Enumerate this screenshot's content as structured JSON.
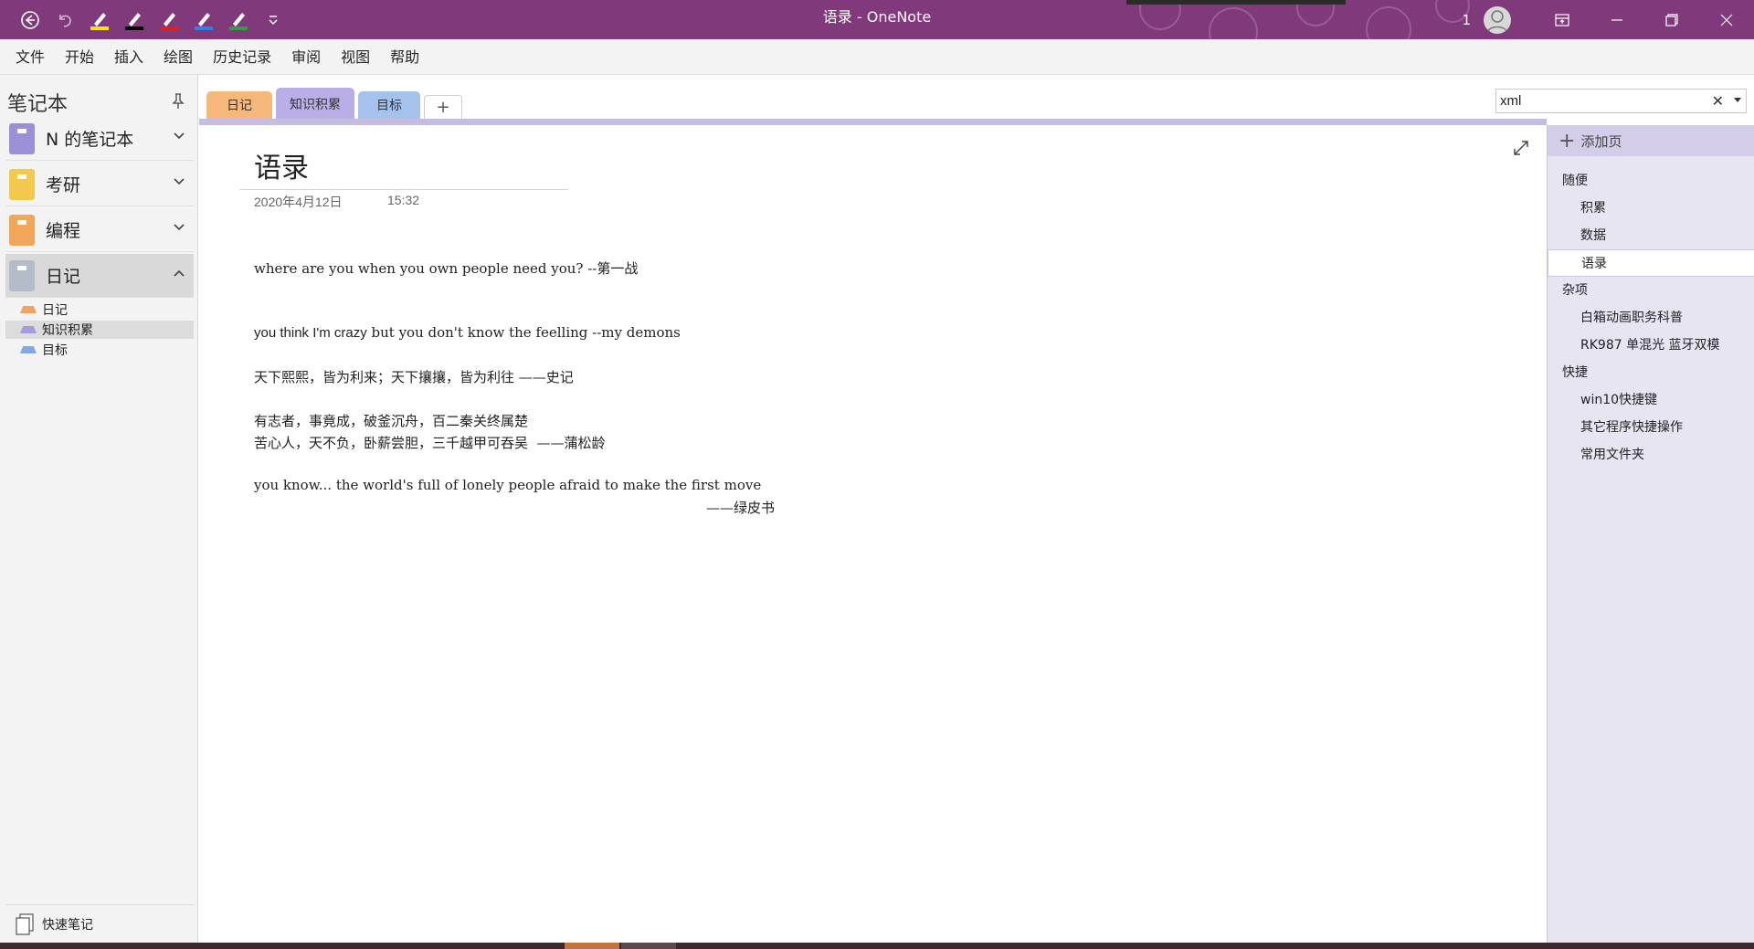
{
  "window": {
    "title": "语录 - OneNote",
    "user_count": "1"
  },
  "quick_access": [
    {
      "icon": "back-icon"
    },
    {
      "icon": "undo-icon"
    },
    {
      "icon": "highlighter-yellow-icon",
      "color": "#f5e500"
    },
    {
      "icon": "pen-black-icon",
      "color": "#000000"
    },
    {
      "icon": "pen-red-icon",
      "color": "#e0201c"
    },
    {
      "icon": "pen-blue-icon",
      "color": "#2f7fe8"
    },
    {
      "icon": "pen-green-icon",
      "color": "#2ea043"
    },
    {
      "icon": "customize-dropdown-icon"
    }
  ],
  "menu": [
    "文件",
    "开始",
    "插入",
    "绘图",
    "历史记录",
    "审阅",
    "视图",
    "帮助"
  ],
  "left_pane": {
    "header": "笔记本",
    "notebooks": [
      {
        "label": "N 的笔记本",
        "color": "#9b8fd6",
        "expanded": false
      },
      {
        "label": "考研",
        "color": "#f2c94c",
        "expanded": false
      },
      {
        "label": "编程",
        "color": "#f2a65a",
        "expanded": false
      },
      {
        "label": "日记",
        "color": "#b5bcc9",
        "expanded": true
      }
    ],
    "sections": [
      {
        "label": "日记",
        "color": "#f0a461"
      },
      {
        "label": "知识积累",
        "color": "#a89bdc"
      },
      {
        "label": "目标",
        "color": "#7fa9e0"
      }
    ],
    "quick_notes": "快速笔记"
  },
  "tabs": [
    {
      "label": "日记",
      "color": "#f6b77a"
    },
    {
      "label": "知识积累",
      "color": "#b9aee6"
    },
    {
      "label": "目标",
      "color": "#a5c2ec"
    }
  ],
  "tab_add": "+",
  "search": {
    "value": "xml"
  },
  "page": {
    "title": "语录",
    "date": "2020年4月12日",
    "time": "15:32",
    "lines": {
      "l1": "where are you when you own people need you? --第一战",
      "l2_sans": "you think I'm crazy",
      "l2_rest": " but you don't know the feelling --my demons",
      "l3": "天下熙熙，皆为利来；天下攘攘，皆为利往 ——史记",
      "l4": "有志者，事竟成，破釜沉舟，百二秦关终属楚",
      "l5": "苦心人，天不负，卧薪尝胆，三千越甲可吞吴  ——蒲松龄",
      "l6": "you know... the world's full of lonely people afraid to make the first move",
      "l7": "——绿皮书"
    }
  },
  "right_pane": {
    "add_page": "添加页",
    "pages": [
      {
        "label": "随便",
        "level": "top"
      },
      {
        "label": "积累",
        "level": "sub"
      },
      {
        "label": "数据",
        "level": "sub"
      },
      {
        "label": "语录",
        "level": "sub",
        "active": true
      },
      {
        "label": "杂项",
        "level": "top"
      },
      {
        "label": "白箱动画职务科普",
        "level": "sub"
      },
      {
        "label": "RK987 单混光 蓝牙双模",
        "level": "sub"
      },
      {
        "label": "快捷",
        "level": "top"
      },
      {
        "label": "win10快捷键",
        "level": "sub"
      },
      {
        "label": "其它程序快捷操作",
        "level": "sub"
      },
      {
        "label": "常用文件夹",
        "level": "sub"
      }
    ]
  }
}
